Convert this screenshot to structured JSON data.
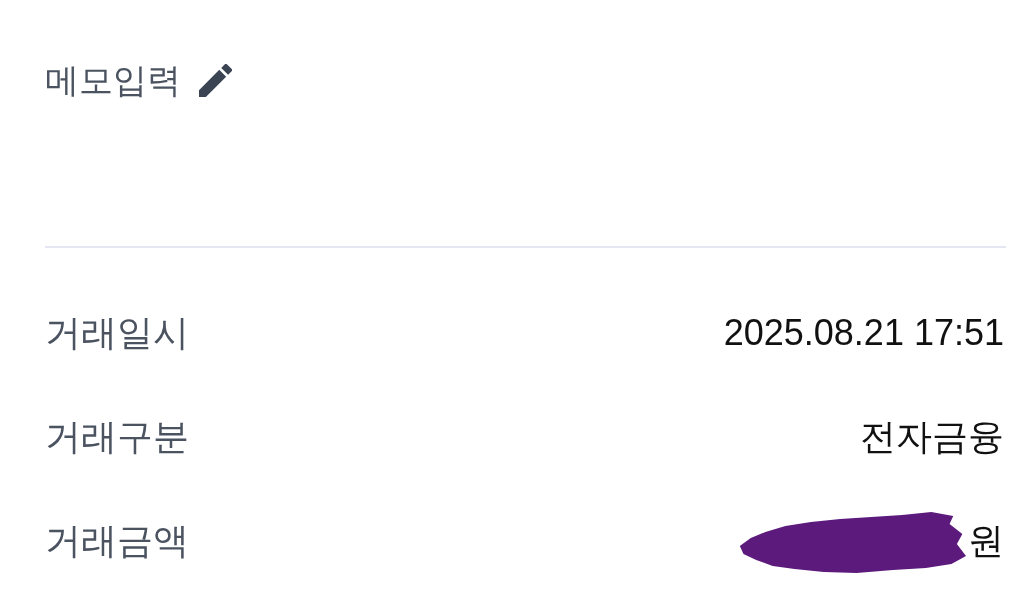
{
  "memo": {
    "label": "메모입력"
  },
  "details": [
    {
      "label": "거래일시",
      "value": "2025.08.21 17:51",
      "redacted": false
    },
    {
      "label": "거래구분",
      "value": "전자금융",
      "redacted": false
    },
    {
      "label": "거래금액",
      "value": "원",
      "redacted": true
    }
  ]
}
